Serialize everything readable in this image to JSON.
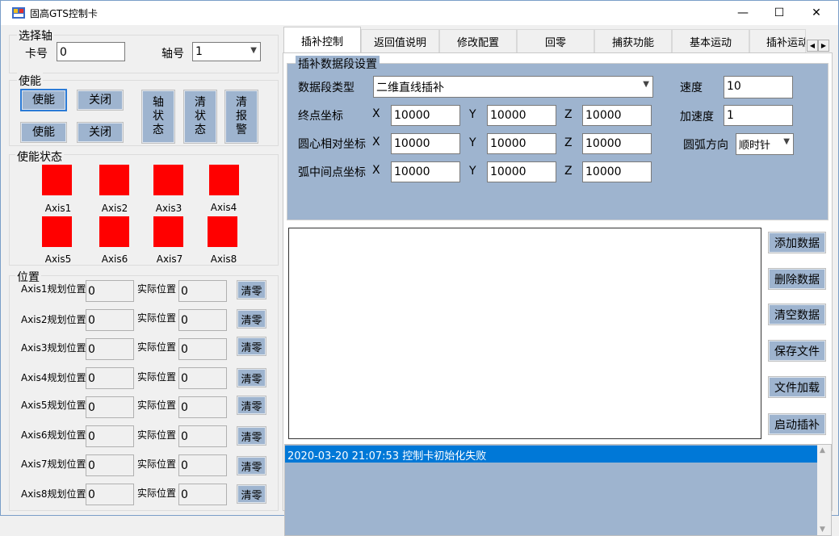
{
  "window": {
    "title": "固高GTS控制卡",
    "minimize": "—",
    "maximize": "☐",
    "close": "✕"
  },
  "select_axis": {
    "title": "选择轴",
    "card_label": "卡号",
    "card_value": "0",
    "axis_label": "轴号",
    "axis_value": "1"
  },
  "enable": {
    "title": "使能",
    "enable1": "使能",
    "close1": "关闭",
    "enable2": "使能",
    "close2": "关闭",
    "axis_status": "轴\n状\n态",
    "clear_status": "清\n状\n态",
    "clear_alarm": "清\n报\n警"
  },
  "enable_status": {
    "title": "使能状态",
    "axes": [
      "Axis1",
      "Axis2",
      "Axis3",
      "Axis4",
      "Axis5",
      "Axis6",
      "Axis7",
      "Axis8"
    ],
    "color": "#ff0000"
  },
  "position": {
    "title": "位置",
    "planned_labels": [
      "Axis1规划位置",
      "Axis2规划位置",
      "Axis3规划位置",
      "Axis4规划位置",
      "Axis5规划位置",
      "Axis6规划位置",
      "Axis7规划位置",
      "Axis8规划位置"
    ],
    "planned_values": [
      "0",
      "0",
      "0",
      "0",
      "0",
      "0",
      "0",
      "0"
    ],
    "actual_label": "实际位置",
    "actual_values": [
      "0",
      "0",
      "0",
      "0",
      "0",
      "0",
      "0",
      "0"
    ],
    "clear_label": "清零"
  },
  "tabs": [
    "插补控制",
    "返回值说明",
    "修改配置",
    "回零",
    "捕获功能",
    "基本运动",
    "插补运动"
  ],
  "interp": {
    "title": "插补数据段设置",
    "seg_type_label": "数据段类型",
    "seg_type_value": "二维直线插补",
    "speed_label": "速度",
    "speed_value": "10",
    "end_label": "终点坐标",
    "center_label": "圆心相对坐标",
    "mid_label": "弧中间点坐标",
    "acc_label": "加速度",
    "acc_value": "1",
    "dir_label": "圆弧方向",
    "dir_value": "顺时针",
    "x": "X",
    "y": "Y",
    "z": "Z",
    "end": [
      "10000",
      "10000",
      "10000"
    ],
    "center": [
      "10000",
      "10000",
      "10000"
    ],
    "mid": [
      "10000",
      "10000",
      "10000"
    ]
  },
  "actions": [
    "添加数据",
    "删除数据",
    "清空数据",
    "保存文件",
    "文件加载",
    "启动插补"
  ],
  "log": {
    "entry": "2020-03-20 21:07:53 控制卡初始化失败"
  },
  "colors": {
    "panel": "#9eb4cf",
    "selected": "#0078d7"
  }
}
